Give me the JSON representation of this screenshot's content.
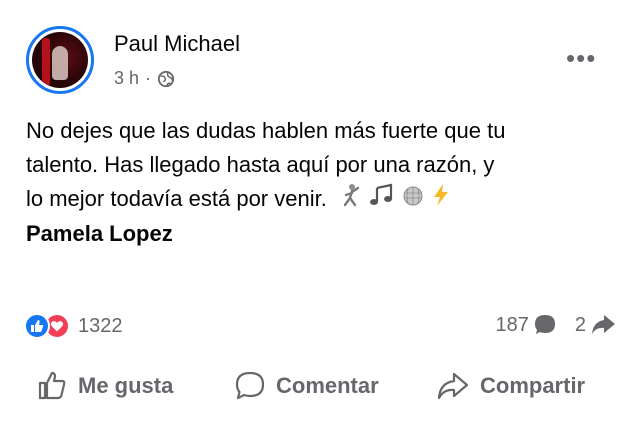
{
  "post": {
    "author": "Paul Michael",
    "time": "3 h",
    "separator": "·",
    "privacy_icon": "globe-icon",
    "more_icon": "more-options-icon",
    "text_line1": "No dejes que las dudas hablen más fuerte que tu",
    "text_line2": "talento. Has llegado hasta aquí por una razón, y",
    "text_line3": "lo mejor todavía está por venir.",
    "emoji_icons": [
      "dancer-icon",
      "music-notes-icon",
      "disco-ball-icon",
      "lightning-icon"
    ],
    "mention": "Pamela Lopez"
  },
  "stats": {
    "reactions_count": "1322",
    "reaction_icons": [
      "like-reaction-icon",
      "love-reaction-icon"
    ],
    "comments_count": "187",
    "shares_count": "2"
  },
  "actions": {
    "like_label": "Me gusta",
    "comment_label": "Comentar",
    "share_label": "Compartir"
  },
  "colors": {
    "accent": "#1877f2",
    "love": "#f33e58",
    "secondary_text": "#65676b",
    "primary_text": "#050505"
  }
}
